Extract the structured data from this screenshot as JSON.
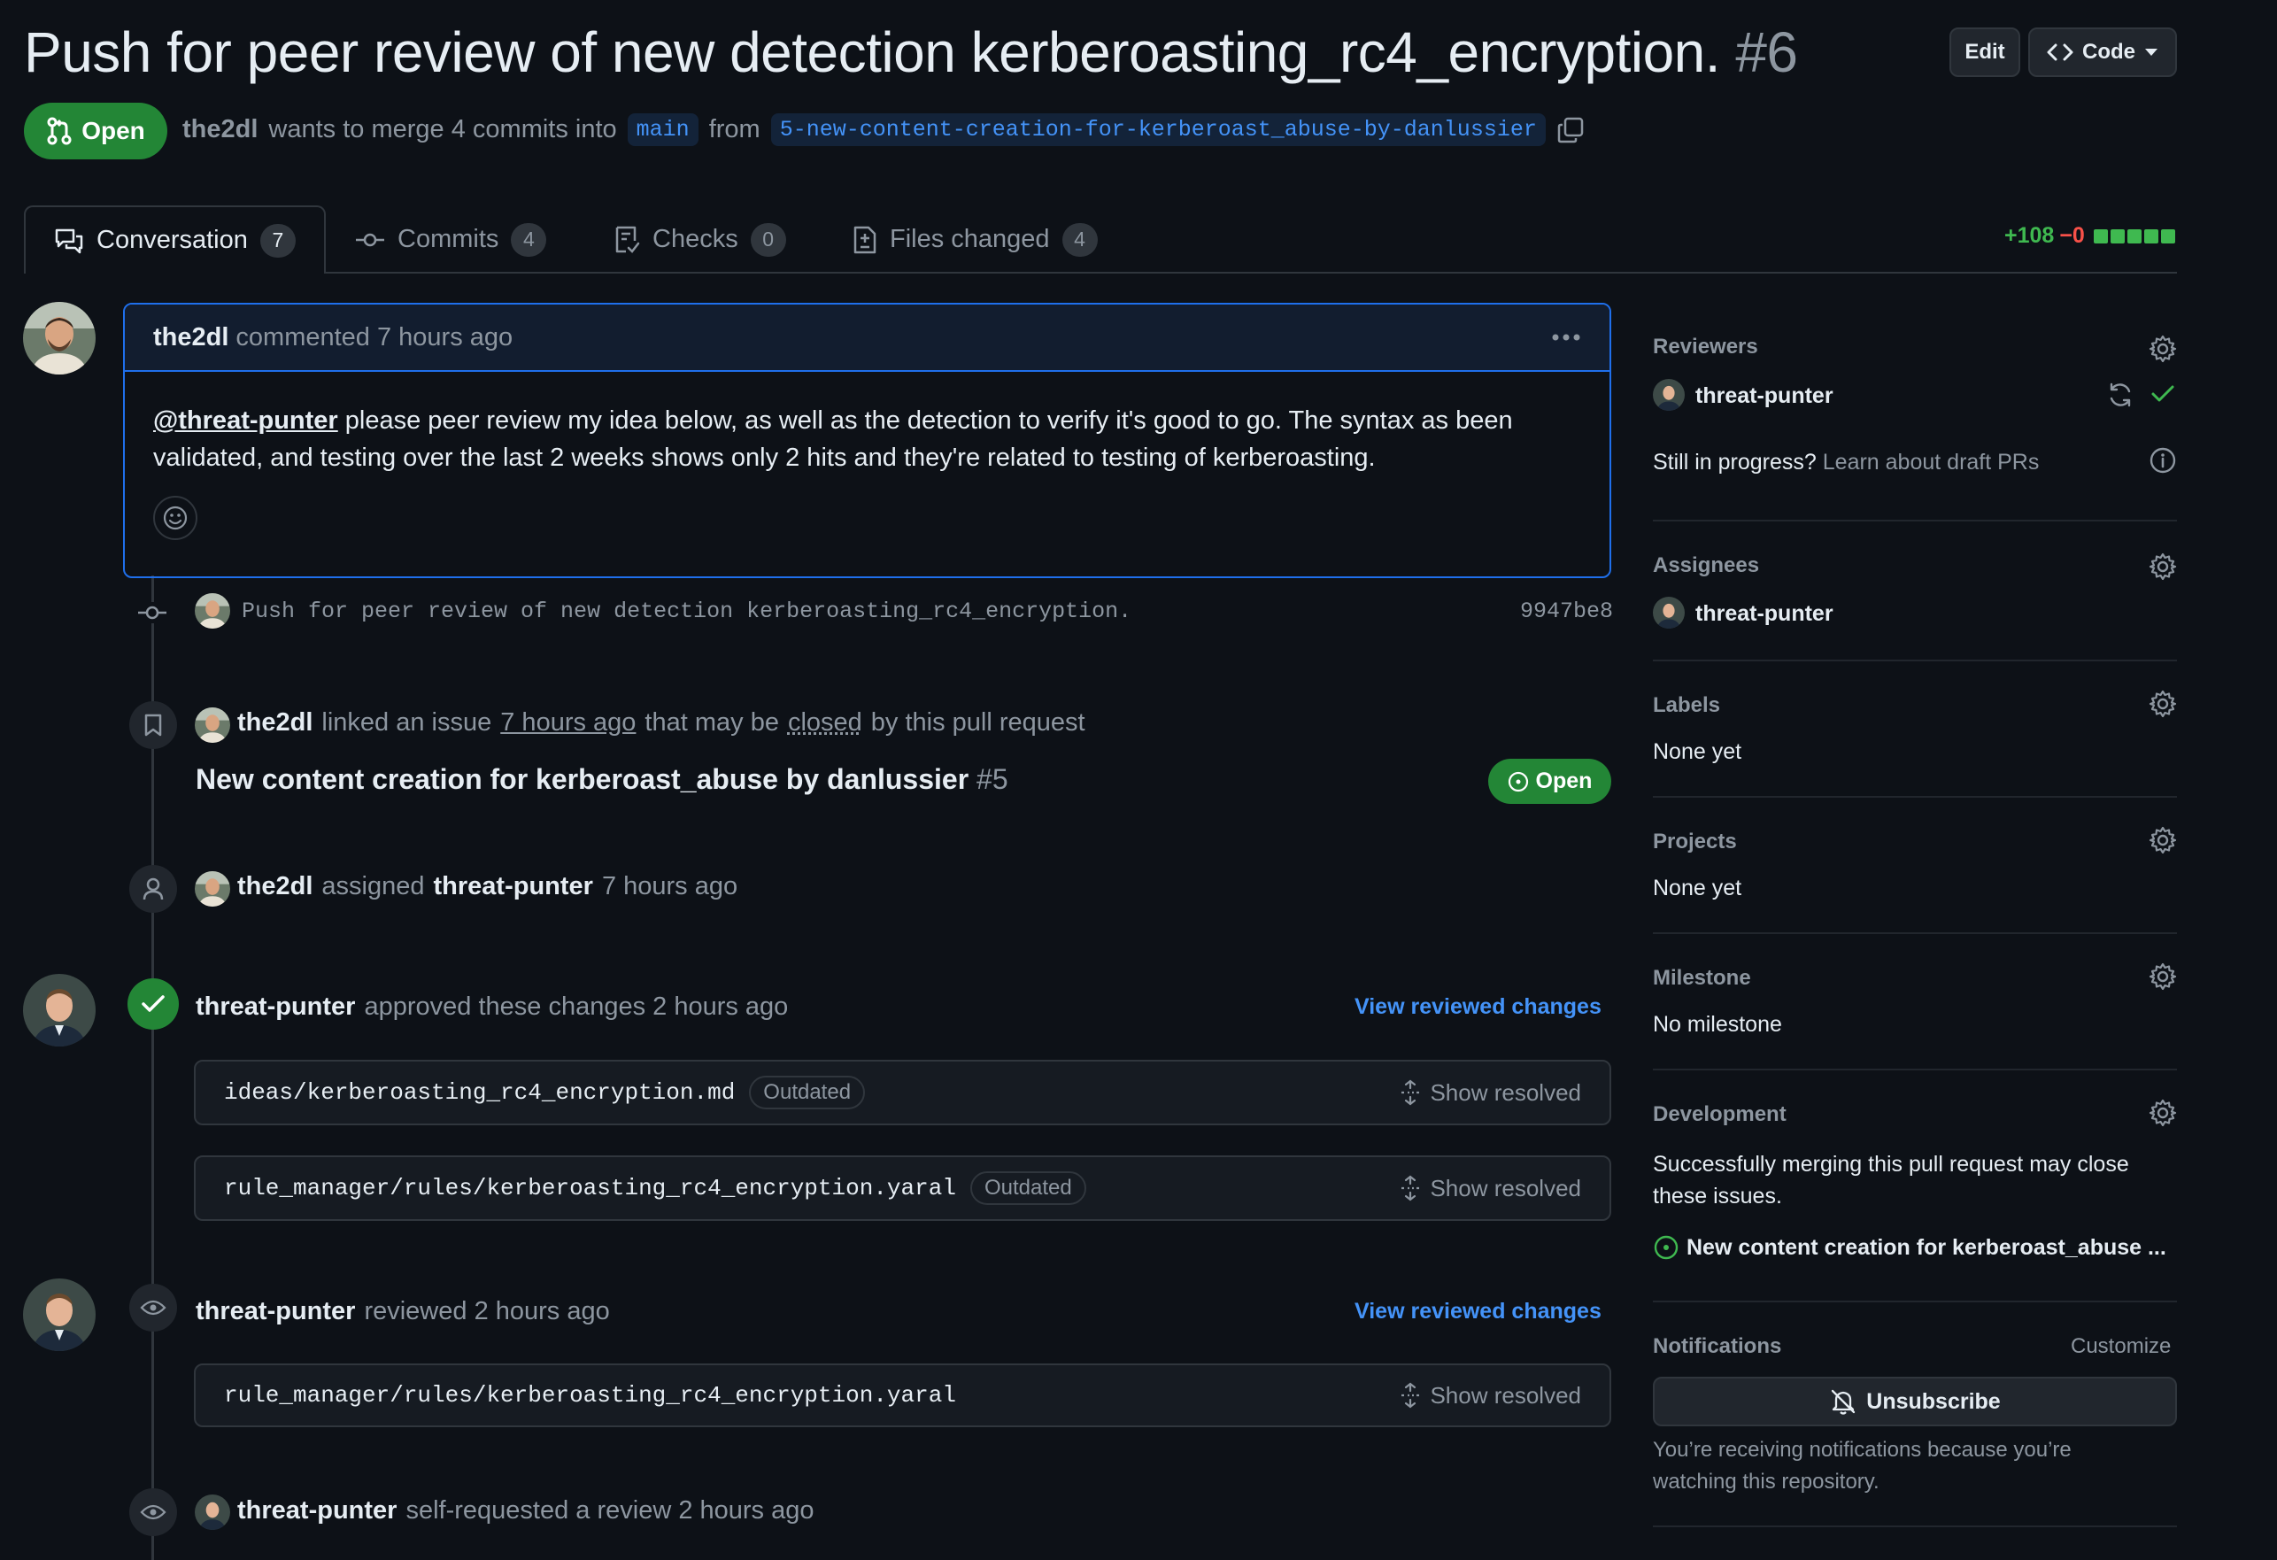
{
  "header": {
    "title": "Push for peer review of new detection kerberoasting_rc4_encryption.",
    "number": "#6",
    "edit_label": "Edit",
    "code_label": "Code",
    "state": "Open",
    "author": "the2dl",
    "merge_text": "wants to merge 4 commits into",
    "base_branch": "main",
    "from_text": "from",
    "head_branch": "5-new-content-creation-for-kerberoast_abuse-by-danlussier"
  },
  "tabs": [
    {
      "label": "Conversation",
      "count": "7"
    },
    {
      "label": "Commits",
      "count": "4"
    },
    {
      "label": "Checks",
      "count": "0"
    },
    {
      "label": "Files changed",
      "count": "4"
    }
  ],
  "diffstat": {
    "additions": "+108",
    "deletions": "−0"
  },
  "comment": {
    "author": "the2dl",
    "action": "commented 7 hours ago",
    "mention": "@threat-punter",
    "body_line1": " please peer review my idea below, as well as the detection to verify it's good to go. The syntax as been",
    "body_line2": "validated, and testing over the last 2 weeks shows only 2 hits and they're related to testing of kerberoasting."
  },
  "commit": {
    "message": "Push for peer review of new detection kerberoasting_rc4_encryption.",
    "sha": "9947be8"
  },
  "linked_issue": {
    "actor": "the2dl",
    "text_a": "linked an issue",
    "time": "7 hours ago",
    "text_b": "that may be",
    "closed": "closed",
    "text_c": "by this pull request",
    "issue_title": "New content creation for kerberoast_abuse by danlussier",
    "issue_number": "#5",
    "issue_state": "Open"
  },
  "assigned": {
    "actor": "the2dl",
    "verb": "assigned",
    "target": "threat-punter",
    "time": "7 hours ago"
  },
  "approval": {
    "actor": "threat-punter",
    "text": "approved these changes 2 hours ago",
    "view_label": "View reviewed changes",
    "files": [
      {
        "name": "ideas/kerberoasting_rc4_encryption.md",
        "tag": "Outdated",
        "action": "Show resolved"
      },
      {
        "name": "rule_manager/rules/kerberoasting_rc4_encryption.yaral",
        "tag": "Outdated",
        "action": "Show resolved"
      }
    ]
  },
  "review": {
    "actor": "threat-punter",
    "text": "reviewed 2 hours ago",
    "view_label": "View reviewed changes",
    "file": {
      "name": "rule_manager/rules/kerberoasting_rc4_encryption.yaral",
      "action": "Show resolved"
    }
  },
  "self_request": {
    "actor": "threat-punter",
    "text": "self-requested a review 2 hours ago"
  },
  "sidebar": {
    "reviewers": {
      "heading": "Reviewers",
      "name": "threat-punter",
      "draft_q": "Still in progress?",
      "draft_link": "Learn about draft PRs"
    },
    "assignees": {
      "heading": "Assignees",
      "name": "threat-punter"
    },
    "labels": {
      "heading": "Labels",
      "value": "None yet"
    },
    "projects": {
      "heading": "Projects",
      "value": "None yet"
    },
    "milestone": {
      "heading": "Milestone",
      "value": "No milestone"
    },
    "development": {
      "heading": "Development",
      "line1": "Successfully merging this pull request may close",
      "line2": "these issues.",
      "issue": "New content creation for kerberoast_abuse ..."
    },
    "notifications": {
      "heading": "Notifications",
      "customize": "Customize",
      "unsubscribe": "Unsubscribe",
      "line1": "You’re receiving notifications because you’re",
      "line2": "watching this repository."
    }
  },
  "colors": {
    "accent": "#4493f8",
    "success": "#238636",
    "danger": "#f85149",
    "add": "#3fb950"
  }
}
